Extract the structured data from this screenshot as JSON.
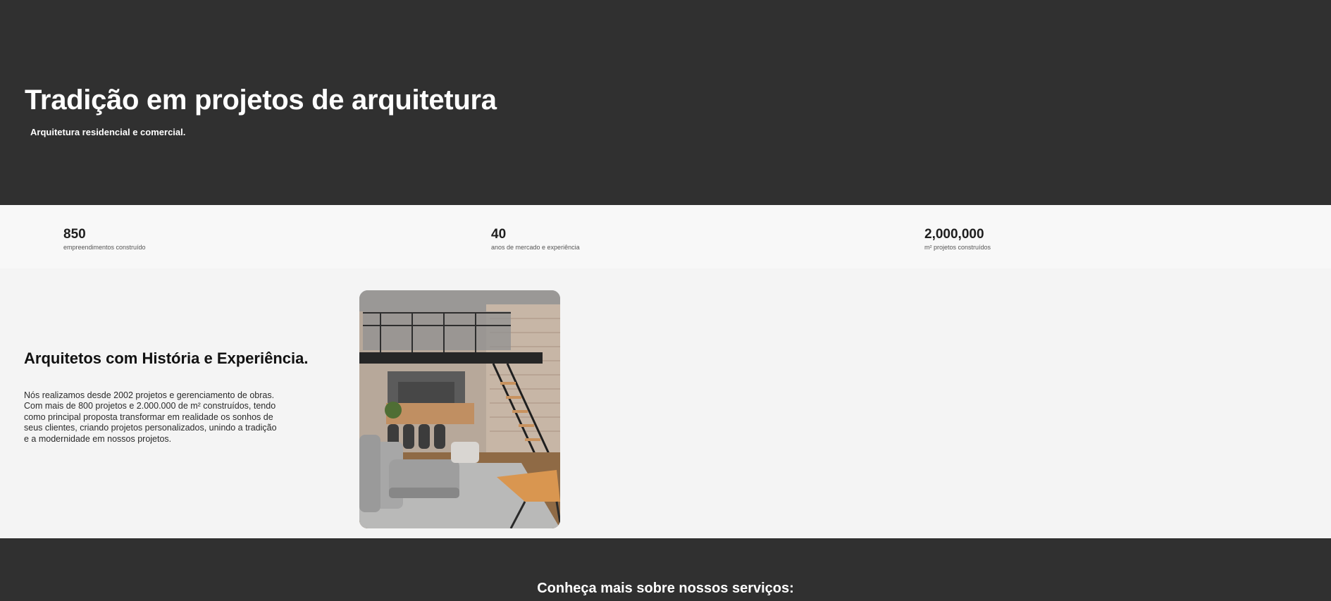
{
  "hero": {
    "title": "Tradição em projetos de arquitetura",
    "subtitle": "Arquitetura residencial e comercial."
  },
  "stats": [
    {
      "value": "850",
      "label": "empreendimentos construído"
    },
    {
      "value": "40",
      "label": "anos de mercado e experiência"
    },
    {
      "value": "2,000,000",
      "label": "m² projetos construídos"
    }
  ],
  "about": {
    "title": "Arquitetos com História e Experiência.",
    "paragraph_lines": [
      "Nós realizamos desde 2002 projetos e gerenciamento de obras.",
      "Com mais de 800 projetos e 2.000.000 de m² construídos, tendo",
      "como principal proposta transformar em realidade os sonhos de",
      "seus clientes, criando projetos personalizados, unindo a tradição",
      "e a modernidade em nossos projetos."
    ]
  },
  "services": {
    "title": "Conheça mais sobre nossos serviços:"
  },
  "colors": {
    "dark_band": "#303030",
    "stats_band": "#f8f8f8",
    "content_bg": "#f4f4f4",
    "text_light": "#ffffff",
    "text_dark": "#111111"
  }
}
